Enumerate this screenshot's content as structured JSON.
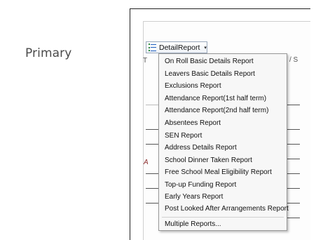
{
  "side_label": "Primary",
  "toolbar": {
    "detail_report_label": "DetailReport",
    "caret": "▾"
  },
  "background": {
    "col_t": "T",
    "col_s": "/ S",
    "col_a": "A"
  },
  "menu": {
    "items": [
      "On Roll Basic Details Report",
      "Leavers Basic Details Report",
      "Exclusions Report",
      "Attendance Report(1st half term)",
      "Attendance Report(2nd half term)",
      "Absentees Report",
      "SEN Report",
      "Address Details Report",
      "School Dinner Taken Report",
      "Free School Meal Eligibility Report",
      "Top-up Funding Report",
      "Early Years Report",
      "Post Looked After Arrangements Report"
    ],
    "multiple": "Multiple Reports..."
  }
}
